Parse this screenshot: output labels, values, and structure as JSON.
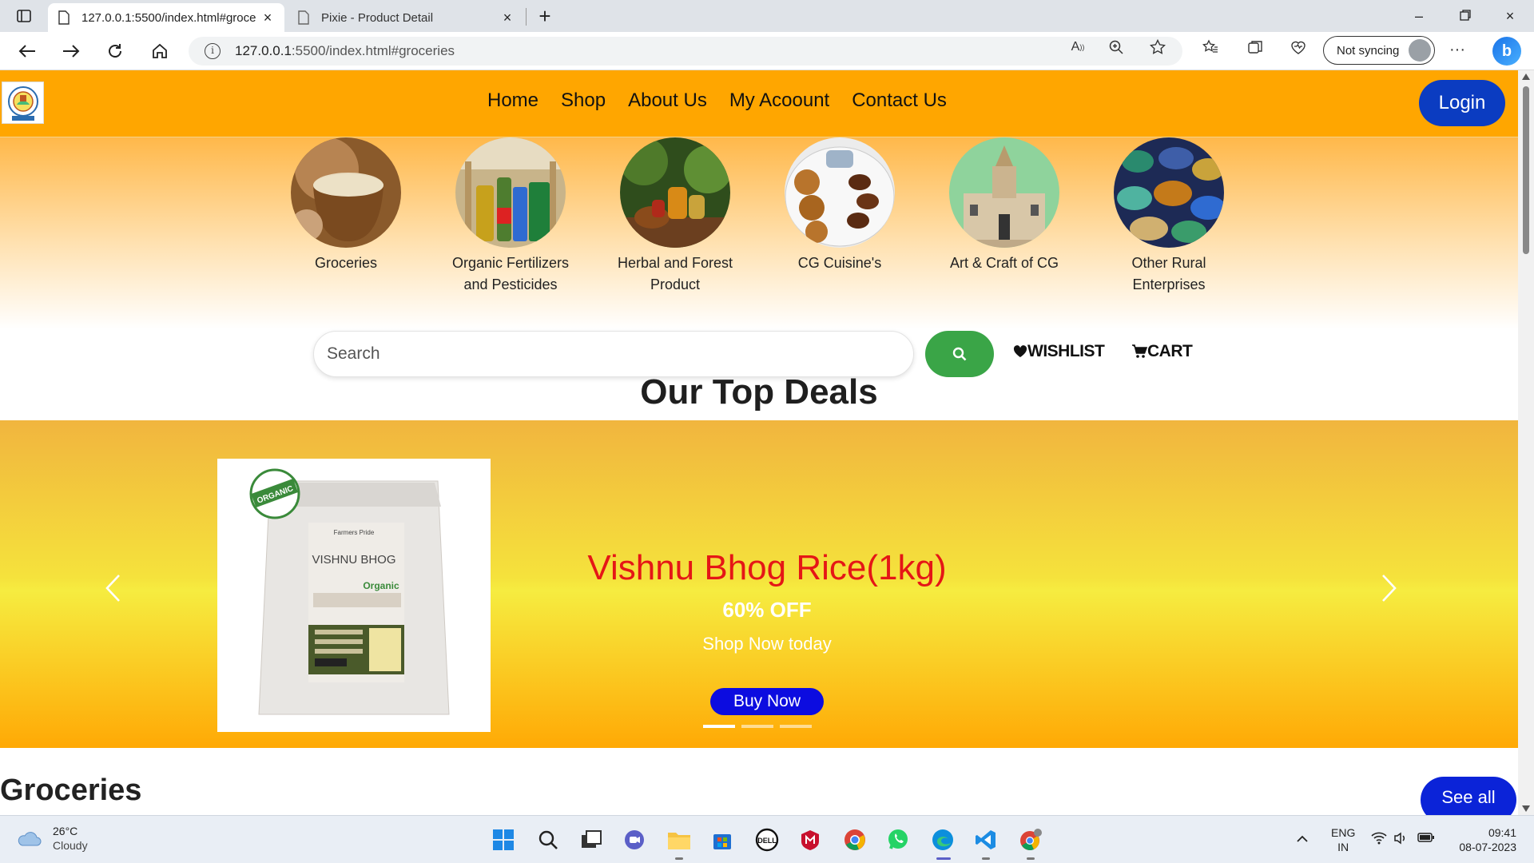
{
  "browser": {
    "active_tab_title": "127.0.0.1:5500/index.html#groce",
    "inactive_tab_title": "Pixie - Product Detail",
    "url_host": "127.0.0.1",
    "url_path": ":5500/index.html#groceries",
    "sync_label": "Not syncing"
  },
  "nav": {
    "items": [
      "Home",
      "Shop",
      "About Us",
      "My Acoount",
      "Contact Us"
    ],
    "login_label": "Login"
  },
  "categories": [
    {
      "label": "Groceries"
    },
    {
      "label": "Organic Fertilizers and Pesticides"
    },
    {
      "label": "Herbal and Forest Product"
    },
    {
      "label": "CG Cuisine's"
    },
    {
      "label": "Art & Craft of CG"
    },
    {
      "label": "Other Rural Enterprises"
    }
  ],
  "search": {
    "placeholder": "Search"
  },
  "links": {
    "wishlist": "WISHLIST",
    "cart": "CART"
  },
  "deals": {
    "heading": "Our Top Deals",
    "slide_title": "Vishnu Bhog Rice(1kg)",
    "discount": "60% OFF",
    "tagline": "Shop Now today",
    "buy_label": "Buy Now",
    "active_slide": 0,
    "slide_count": 3
  },
  "product_pack": {
    "brand": "Farmers Pride",
    "name": "VISHNU BHOG",
    "sub": "Organic",
    "badge": "ORGANIC"
  },
  "groceries": {
    "heading": "Groceries",
    "see_all_label": "See all"
  },
  "taskbar": {
    "temperature": "26°C",
    "weather": "Cloudy",
    "lang": "ENG",
    "region": "IN",
    "time": "09:41",
    "date": "08-07-2023"
  },
  "colors": {
    "nav_bg": "#ffa600",
    "login_bg": "#0b3cc1",
    "search_btn": "#3aa547",
    "deal_title": "#e51616",
    "buy_btn": "#0c0ce0"
  }
}
